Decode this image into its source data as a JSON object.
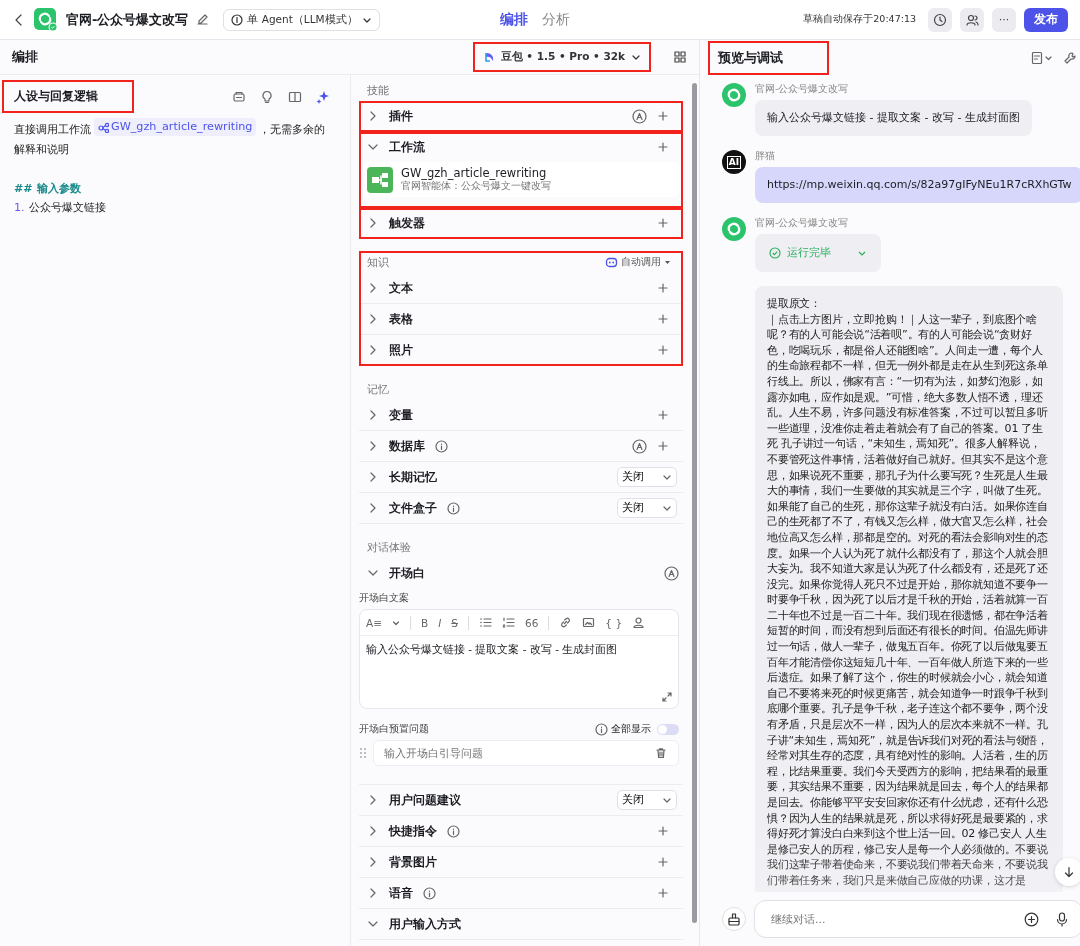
{
  "topbar": {
    "title": "官网-公众号爆文改写",
    "mode": "单 Agent（LLM模式）",
    "tabs": [
      {
        "label": "编排",
        "selected": true
      },
      {
        "label": "分析",
        "selected": false
      }
    ],
    "autosave": "草稿自动保存于20:47:13",
    "more": "···",
    "publish": "发布"
  },
  "editor_header": {
    "title": "编排",
    "model": "豆包 • 1.5 • Pro • 32k",
    "model_highlighted": true
  },
  "persona": {
    "title": "人设与回复逻辑",
    "highlighted": true,
    "intro": "直接调用工作流",
    "workflow_ref": "GW_gzh_article_rewriting",
    "outro": "，无需多余的解释和说明",
    "heading": "## 输入参数",
    "list_number": "1.",
    "list_text": "公众号爆文链接"
  },
  "sections": [
    {
      "title": "技能",
      "highlighted": false,
      "rows": [
        {
          "label": "插件",
          "kind": "row",
          "expanded": false,
          "highlighted": true,
          "info": false,
          "auto": true,
          "add": true
        },
        {
          "label": "工作流",
          "kind": "row",
          "expanded": true,
          "highlighted": true,
          "info": false,
          "auto": false,
          "add": true,
          "card": {
            "name": "GW_gzh_article_rewriting",
            "desc": "官网智能体：公众号爆文一键改写"
          }
        },
        {
          "label": "触发器",
          "kind": "row",
          "expanded": false,
          "highlighted": true,
          "info": false,
          "auto": false,
          "add": true
        }
      ]
    },
    {
      "title": "知识",
      "highlighted": true,
      "mode": "自动调用",
      "rows": [
        {
          "label": "文本",
          "kind": "row",
          "expanded": false,
          "highlighted": false,
          "info": false,
          "auto": false,
          "add": true
        },
        {
          "label": "表格",
          "kind": "row",
          "expanded": false,
          "highlighted": false,
          "info": false,
          "auto": false,
          "add": true
        },
        {
          "label": "照片",
          "kind": "row",
          "expanded": false,
          "highlighted": false,
          "info": false,
          "auto": false,
          "add": true
        }
      ]
    },
    {
      "title": "记忆",
      "highlighted": false,
      "rows": [
        {
          "label": "变量",
          "kind": "row",
          "expanded": false,
          "highlighted": false,
          "info": false,
          "auto": false,
          "add": true
        },
        {
          "label": "数据库",
          "kind": "row",
          "expanded": false,
          "highlighted": false,
          "info": true,
          "auto": true,
          "add": true
        },
        {
          "label": "长期记忆",
          "kind": "row",
          "expanded": false,
          "highlighted": false,
          "info": false,
          "auto": false,
          "add": false,
          "select": "关闭"
        },
        {
          "label": "文件盒子",
          "kind": "row",
          "expanded": false,
          "highlighted": false,
          "info": true,
          "auto": false,
          "add": false,
          "select": "关闭"
        }
      ]
    },
    {
      "title": "对话体验",
      "highlighted": false,
      "rows": [
        {
          "label": "开场白",
          "kind": "opening",
          "expanded": true,
          "highlighted": false,
          "info": false,
          "auto": true,
          "add": false,
          "editor_label": "开场白文案",
          "toolbar": [
            "A≡",
            "B",
            "I",
            "S",
            "66",
            "{ }"
          ],
          "text": "输入公众号爆文链接 - 提取文案 - 改写 - 生成封面图",
          "questions_label": "开场白预置问题",
          "show_all": "全部显示",
          "show_all_on": false,
          "question_placeholder": "输入开场白引导问题"
        },
        {
          "label": "用户问题建议",
          "kind": "row",
          "expanded": false,
          "highlighted": false,
          "info": false,
          "auto": false,
          "add": false,
          "select": "关闭"
        },
        {
          "label": "快捷指令",
          "kind": "row",
          "expanded": false,
          "highlighted": false,
          "info": true,
          "auto": false,
          "add": true
        },
        {
          "label": "背景图片",
          "kind": "row",
          "expanded": false,
          "highlighted": false,
          "info": false,
          "auto": false,
          "add": true
        },
        {
          "label": "语音",
          "kind": "row",
          "expanded": false,
          "highlighted": false,
          "info": true,
          "auto": false,
          "add": true
        },
        {
          "label": "用户输入方式",
          "kind": "row",
          "expanded": true,
          "highlighted": false,
          "info": false,
          "auto": false,
          "add": false
        }
      ]
    }
  ],
  "preview": {
    "title": "预览与调试",
    "highlighted": true,
    "input_placeholder": "继续对话...",
    "messages": [
      {
        "kind": "bot",
        "sender": "官网-公众号爆文改写",
        "text": "输入公众号爆文链接 - 提取文案 - 改写 - 生成封面图"
      },
      {
        "kind": "user",
        "sender": "胖猫",
        "avatar": "AI",
        "text": "https://mp.weixin.qq.com/s/82a97gIFyNEu1R7cRXhGTw"
      },
      {
        "kind": "bot",
        "sender": "官网-公众号爆文改写",
        "status": "运行完毕"
      },
      {
        "kind": "continuation",
        "heading": "提取原文：",
        "text": "｜点击上方图片，立即抢购！｜人这一辈子，到底图个啥呢？有的人可能会说“活着呗”。有的人可能会说“贪财好色，吃喝玩乐，都是俗人还能图啥”。人间走一遭，每个人的生命旅程都不一样，但无一例外都是走在从生到死这条单行线上。所以，佛家有言：“一切有为法，如梦幻泡影，如露亦如电，应作如是观。”可惜，绝大多数人悟不透，理还乱。人生不易，许多问题没有标准答案，不过可以暂且多听一些道理，没准你走着走着就会有了自己的答案。01 了生死 孔子讲过一句话，“未知生，焉知死”。很多人解释说，不要管死这件事情，活着做好自己就好。但其实不是这个意思，如果说死不重要，那孔子为什么要写死？生死是人生最大的事情，我们一生要做的其实就是三个字，叫做了生死。如果能了自己的生死，那你这辈子就没有白活。如果你连自己的生死都了不了，有钱又怎么样，做大官又怎么样，社会地位高又怎么样，那都是空的。对死的看法会影响对生的态度。如果一个人认为死了就什么都没有了，那这个人就会胆大妄为。我不知道大家是认为死了什么都没有，还是死了还没完。如果你觉得人死只不过是开始，那你就知道不要争一时要争千秋，因为死了以后才是千秋的开始，活着就算一百二十年也不过是一百二十年。我们现在很遗憾，都在争活着短暂的时间，而没有想到后面还有很长的时间。伯温先师讲过一句话，做人一辈子，做鬼五百年。你死了以后做鬼要五百年才能清偿你这短短几十年、一百年做人所造下来的一些后遗症。如果了解了这个，你生的时候就会小心，就会知道自己不要将来死的时候更痛苦，就会知道争一时跟争千秋到底哪个重要。孔子是争千秋，老子连这个都不要争，两个没有矛盾，只是层次不一样，因为人的层次本来就不一样。孔子讲“未知生，焉知死”，就是告诉我们对死的看法与领悟，经常对其生存的态度，具有绝对性的影响。人活着，生的历程，比结果重要。我们今天受西方的影响，把结果看的最重要，其实结果不重要，因为结果就是回去，每个人的结果都是回去。你能够平平安安回家你还有什么忧虑，还有什么恐惧？因为人生的结果就是死，所以求得好死是最要紧的，求得好死才算没白白来到这个世上活一回。02 修己安人 人生是修己安人的历程，修己安人是每一个人必须做的。不要说我们这辈子带着使命来，不要说我们带着天命来，不要说我们带着任务来，我们只是来做自己应做的功课，这才是"
      }
    ]
  }
}
